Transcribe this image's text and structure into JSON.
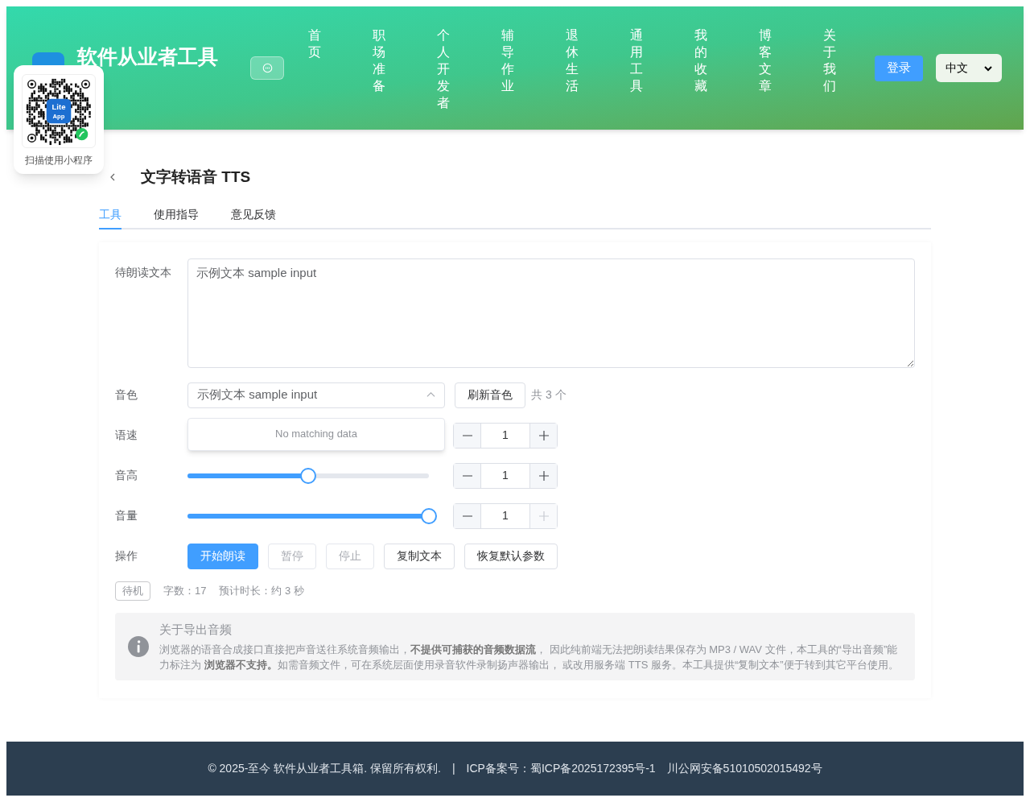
{
  "header": {
    "site_title": "软件从业者工具",
    "nav": [
      {
        "label": "首页"
      },
      {
        "label": "职场准备"
      },
      {
        "label": "个人开发者"
      },
      {
        "label": "辅导作业"
      },
      {
        "label": "退休生活"
      },
      {
        "label": "通用工具"
      },
      {
        "label": "我的收藏"
      },
      {
        "label": "博客文章"
      },
      {
        "label": "关于我们"
      }
    ],
    "login": "登录",
    "language": "中文"
  },
  "qr_popup": {
    "logo_lines": [
      "Lite",
      "App"
    ],
    "caption": "扫描使用小程序"
  },
  "page_title": "文字转语音 TTS",
  "tabs": [
    {
      "label": "工具",
      "selected": true
    },
    {
      "label": "使用指导",
      "selected": false
    },
    {
      "label": "意见反馈",
      "selected": false
    }
  ],
  "form": {
    "text_label": "待朗读文本",
    "text_value": "示例文本 sample input",
    "voice_label": "音色",
    "voice_value": "示例文本 sample input",
    "voice_open": true,
    "refresh": "刷新音色",
    "voice_count": "共 3 个",
    "dropdown_empty": "No matching data",
    "params": [
      {
        "kind": "number",
        "label": "语速",
        "value": "1",
        "plus_disabled": false
      },
      {
        "kind": "slider",
        "label": "音高",
        "level": 0.5,
        "value": "1",
        "plus_disabled": false
      },
      {
        "kind": "slider",
        "label": "音量",
        "level": 1,
        "value": "1",
        "plus_disabled": true
      }
    ],
    "actions_label": "操作",
    "actions": [
      {
        "label": "开始朗读",
        "primary": true,
        "disabled": false
      },
      {
        "label": "暂停",
        "primary": false,
        "disabled": true
      },
      {
        "label": "停止",
        "primary": false,
        "disabled": true
      },
      {
        "label": "复制文本",
        "primary": false,
        "disabled": false
      },
      {
        "label": "恢复默认参数",
        "primary": false,
        "disabled": false
      }
    ],
    "status": "待机",
    "char_count": "字数：17",
    "duration": "预计时长：约 3 秒"
  },
  "notice": {
    "title": "关于导出音频",
    "body": "浏览器的语音合成接口直接把声音送往系统音频输出，**不提供可捕获的音频数据流**， 因此纯前端无法把朗读结果保存为 MP3 / WAV 文件，本工具的“导出音频”能力标注为 **浏览器不支持。**如需音频文件，可在系统层面使用录音软件录制扬声器输出， 或改用服务端 TTS 服务。本工具提供“复制文本”便于转到其它平台使用。"
  },
  "footer": {
    "copyright": "© 2025-至今 软件从业者工具箱. 保留所有权利.",
    "separator": "|",
    "icp": "ICP备案号：蜀ICP备2025172395号-1",
    "police": "川公网安备51010502015492号"
  }
}
